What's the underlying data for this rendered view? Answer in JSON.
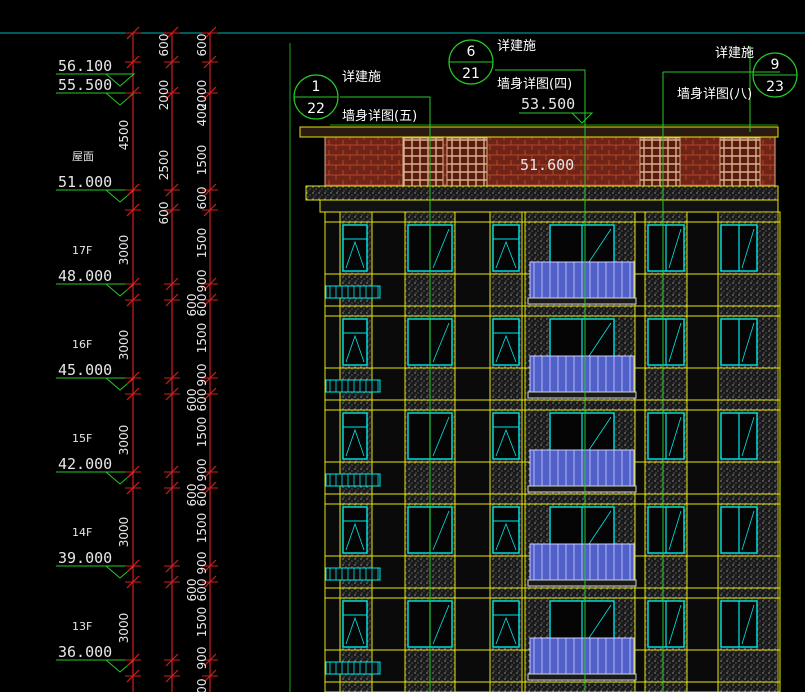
{
  "drawing": {
    "colors": {
      "background": "#000000",
      "green": "#28c828",
      "red": "#d21e1e",
      "cyan": "#00e6e6",
      "yellow": "#e6e60a",
      "brick": "#7a2818",
      "glass": "#5060c8"
    },
    "elevations": [
      {
        "floor": "",
        "value": "56.100"
      },
      {
        "floor": "",
        "value": "55.500"
      },
      {
        "floor": "屋面",
        "value": "51.000"
      },
      {
        "floor": "17F",
        "value": "48.000"
      },
      {
        "floor": "16F",
        "value": "45.000"
      },
      {
        "floor": "15F",
        "value": "42.000"
      },
      {
        "floor": "14F",
        "value": "39.000"
      },
      {
        "floor": "13F",
        "value": "36.000"
      }
    ],
    "outer_dims": [
      "4500",
      "3000",
      "3000",
      "3000",
      "3000",
      "3000"
    ],
    "mid_dims": [
      "600",
      "2000",
      "2500",
      "600"
    ],
    "inner_dims": [
      "600",
      "2000",
      "1500",
      "400",
      "600",
      "1500",
      "900",
      "600",
      "1500",
      "900",
      "600",
      "1500",
      "900",
      "600",
      "1500",
      "900",
      "600",
      "1500",
      "900",
      "600",
      "1500",
      "900"
    ],
    "callouts": [
      {
        "top": "1",
        "bottom": "22",
        "note": "详建施",
        "title": "墙身详图(五)"
      },
      {
        "top": "6",
        "bottom": "21",
        "note": "详建施",
        "title": "墙身详图(四)"
      },
      {
        "top": "9",
        "bottom": "23",
        "note": "详建施",
        "title": "墙身详图(八)"
      }
    ],
    "level_marks": [
      "53.500",
      "51.600"
    ]
  }
}
